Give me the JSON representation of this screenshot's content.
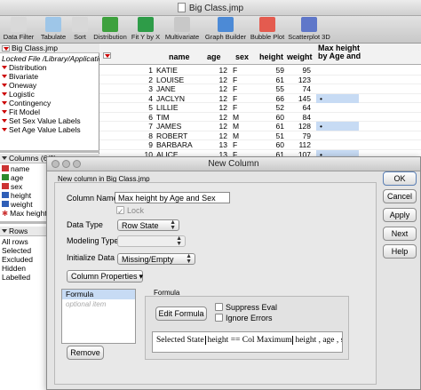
{
  "window": {
    "title": "Big Class.jmp"
  },
  "toolbar": [
    {
      "label": "Data Filter",
      "icon": "data-filter-icon",
      "color": "#d9d9d9"
    },
    {
      "label": "Tabulate",
      "icon": "tabulate-icon",
      "color": "#9ec6e8"
    },
    {
      "label": "Sort",
      "icon": "sort-icon",
      "color": "#d8d8d8"
    },
    {
      "label": "Distribution",
      "icon": "distribution-icon",
      "color": "#3da13d"
    },
    {
      "label": "Fit Y by X",
      "icon": "fit-y-by-x-icon",
      "color": "#2e9c48"
    },
    {
      "label": "Multivariate",
      "icon": "multivariate-icon",
      "color": "#c8c8c8"
    },
    {
      "label": "Graph Builder",
      "icon": "graph-builder-icon",
      "color": "#4c8ad6"
    },
    {
      "label": "Bubble Plot",
      "icon": "bubble-plot-icon",
      "color": "#e45b4f"
    },
    {
      "label": "Scatterplot 3D",
      "icon": "scatterplot-3d-icon",
      "color": "#5f77c9"
    }
  ],
  "table_panel": {
    "title": "Big Class.jmp",
    "subtitle": "Locked File  /Library/Application",
    "scripts": [
      "Distribution",
      "Bivariate",
      "Oneway",
      "Logistic",
      "Contingency",
      "Fit Model",
      "Set Sex Value Labels",
      "Set Age Value Labels"
    ]
  },
  "columns_panel": {
    "title": "Columns (6/0)",
    "items": [
      {
        "name": "name",
        "color": "#c33"
      },
      {
        "name": "age",
        "color": "#2d8a2d"
      },
      {
        "name": "sex",
        "color": "#c33"
      },
      {
        "name": "height",
        "color": "#2f5fb8"
      },
      {
        "name": "weight",
        "color": "#2f5fb8"
      },
      {
        "name": "Max height",
        "color": "#c33"
      }
    ]
  },
  "rows_panel": {
    "title": "Rows",
    "items": [
      "All rows",
      "Selected",
      "Excluded",
      "Hidden",
      "Labelled"
    ]
  },
  "grid": {
    "headers": {
      "name": "name",
      "age": "age",
      "sex": "sex",
      "height": "height",
      "weight": "weight",
      "max": "Max height by Age and"
    },
    "rows": [
      {
        "n": "1",
        "name": "KATIE",
        "age": "12",
        "sex": "F",
        "height": "59",
        "weight": "95",
        "max": "",
        "sel": false
      },
      {
        "n": "2",
        "name": "LOUISE",
        "age": "12",
        "sex": "F",
        "height": "61",
        "weight": "123",
        "max": "",
        "sel": false
      },
      {
        "n": "3",
        "name": "JANE",
        "age": "12",
        "sex": "F",
        "height": "55",
        "weight": "74",
        "max": "",
        "sel": false
      },
      {
        "n": "4",
        "name": "JACLYN",
        "age": "12",
        "sex": "F",
        "height": "66",
        "weight": "145",
        "max": "•",
        "sel": true
      },
      {
        "n": "5",
        "name": "LILLIE",
        "age": "12",
        "sex": "F",
        "height": "52",
        "weight": "64",
        "max": "",
        "sel": false
      },
      {
        "n": "6",
        "name": "TIM",
        "age": "12",
        "sex": "M",
        "height": "60",
        "weight": "84",
        "max": "",
        "sel": false
      },
      {
        "n": "7",
        "name": "JAMES",
        "age": "12",
        "sex": "M",
        "height": "61",
        "weight": "128",
        "max": "•",
        "sel": true
      },
      {
        "n": "8",
        "name": "ROBERT",
        "age": "12",
        "sex": "M",
        "height": "51",
        "weight": "79",
        "max": "",
        "sel": false
      },
      {
        "n": "9",
        "name": "BARBARA",
        "age": "13",
        "sex": "F",
        "height": "60",
        "weight": "112",
        "max": "",
        "sel": false
      },
      {
        "n": "10",
        "name": "ALICE",
        "age": "13",
        "sex": "F",
        "height": "61",
        "weight": "107",
        "max": "•",
        "sel": true
      }
    ]
  },
  "dialog": {
    "title": "New Column",
    "subtitle": "New column in Big Class.jmp",
    "column_name_label": "Column Name",
    "column_name_value": "Max height by Age and Sex",
    "lock_label": "Lock",
    "data_type_label": "Data Type",
    "data_type_value": "Row State",
    "modeling_type_label": "Modeling Type",
    "modeling_type_value": "",
    "initialize_label": "Initialize Data",
    "initialize_value": "Missing/Empty",
    "column_properties_label": "Column Properties",
    "props_items": [
      "Formula"
    ],
    "props_placeholder": "optional item",
    "remove_label": "Remove",
    "formula_group_label": "Formula",
    "edit_formula_label": "Edit Formula",
    "suppress_eval_label": "Suppress Eval",
    "ignore_errors_label": "Ignore Errors",
    "formula": {
      "head": "Selected State",
      "lhs": "height",
      "op": "==",
      "fn": "Col Maximum",
      "args": "height , age , sex"
    },
    "buttons": {
      "ok": "OK",
      "cancel": "Cancel",
      "apply": "Apply",
      "next": "Next",
      "help": "Help"
    }
  }
}
